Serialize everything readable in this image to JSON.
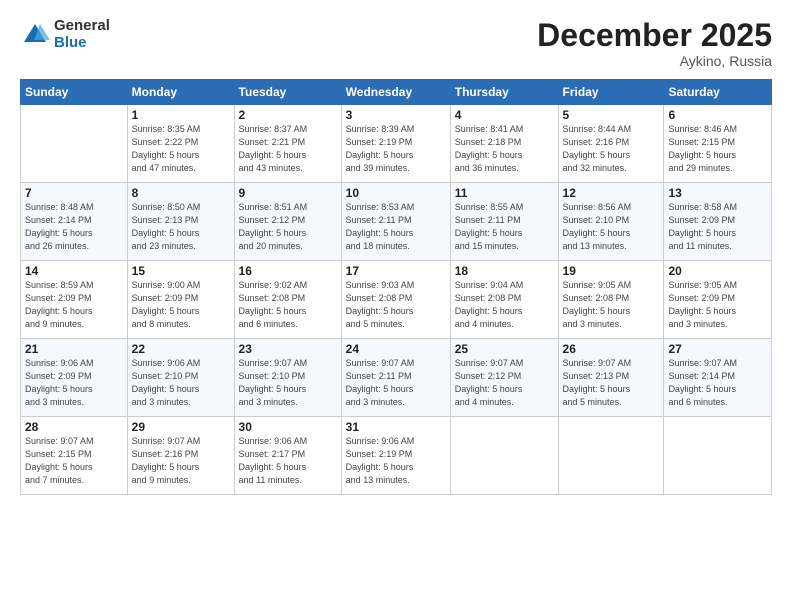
{
  "logo": {
    "general": "General",
    "blue": "Blue"
  },
  "title": "December 2025",
  "location": "Aykino, Russia",
  "days_header": [
    "Sunday",
    "Monday",
    "Tuesday",
    "Wednesday",
    "Thursday",
    "Friday",
    "Saturday"
  ],
  "weeks": [
    [
      {
        "day": "",
        "info": ""
      },
      {
        "day": "1",
        "info": "Sunrise: 8:35 AM\nSunset: 2:22 PM\nDaylight: 5 hours\nand 47 minutes."
      },
      {
        "day": "2",
        "info": "Sunrise: 8:37 AM\nSunset: 2:21 PM\nDaylight: 5 hours\nand 43 minutes."
      },
      {
        "day": "3",
        "info": "Sunrise: 8:39 AM\nSunset: 2:19 PM\nDaylight: 5 hours\nand 39 minutes."
      },
      {
        "day": "4",
        "info": "Sunrise: 8:41 AM\nSunset: 2:18 PM\nDaylight: 5 hours\nand 36 minutes."
      },
      {
        "day": "5",
        "info": "Sunrise: 8:44 AM\nSunset: 2:16 PM\nDaylight: 5 hours\nand 32 minutes."
      },
      {
        "day": "6",
        "info": "Sunrise: 8:46 AM\nSunset: 2:15 PM\nDaylight: 5 hours\nand 29 minutes."
      }
    ],
    [
      {
        "day": "7",
        "info": "Sunrise: 8:48 AM\nSunset: 2:14 PM\nDaylight: 5 hours\nand 26 minutes."
      },
      {
        "day": "8",
        "info": "Sunrise: 8:50 AM\nSunset: 2:13 PM\nDaylight: 5 hours\nand 23 minutes."
      },
      {
        "day": "9",
        "info": "Sunrise: 8:51 AM\nSunset: 2:12 PM\nDaylight: 5 hours\nand 20 minutes."
      },
      {
        "day": "10",
        "info": "Sunrise: 8:53 AM\nSunset: 2:11 PM\nDaylight: 5 hours\nand 18 minutes."
      },
      {
        "day": "11",
        "info": "Sunrise: 8:55 AM\nSunset: 2:11 PM\nDaylight: 5 hours\nand 15 minutes."
      },
      {
        "day": "12",
        "info": "Sunrise: 8:56 AM\nSunset: 2:10 PM\nDaylight: 5 hours\nand 13 minutes."
      },
      {
        "day": "13",
        "info": "Sunrise: 8:58 AM\nSunset: 2:09 PM\nDaylight: 5 hours\nand 11 minutes."
      }
    ],
    [
      {
        "day": "14",
        "info": "Sunrise: 8:59 AM\nSunset: 2:09 PM\nDaylight: 5 hours\nand 9 minutes."
      },
      {
        "day": "15",
        "info": "Sunrise: 9:00 AM\nSunset: 2:09 PM\nDaylight: 5 hours\nand 8 minutes."
      },
      {
        "day": "16",
        "info": "Sunrise: 9:02 AM\nSunset: 2:08 PM\nDaylight: 5 hours\nand 6 minutes."
      },
      {
        "day": "17",
        "info": "Sunrise: 9:03 AM\nSunset: 2:08 PM\nDaylight: 5 hours\nand 5 minutes."
      },
      {
        "day": "18",
        "info": "Sunrise: 9:04 AM\nSunset: 2:08 PM\nDaylight: 5 hours\nand 4 minutes."
      },
      {
        "day": "19",
        "info": "Sunrise: 9:05 AM\nSunset: 2:08 PM\nDaylight: 5 hours\nand 3 minutes."
      },
      {
        "day": "20",
        "info": "Sunrise: 9:05 AM\nSunset: 2:09 PM\nDaylight: 5 hours\nand 3 minutes."
      }
    ],
    [
      {
        "day": "21",
        "info": "Sunrise: 9:06 AM\nSunset: 2:09 PM\nDaylight: 5 hours\nand 3 minutes."
      },
      {
        "day": "22",
        "info": "Sunrise: 9:06 AM\nSunset: 2:10 PM\nDaylight: 5 hours\nand 3 minutes."
      },
      {
        "day": "23",
        "info": "Sunrise: 9:07 AM\nSunset: 2:10 PM\nDaylight: 5 hours\nand 3 minutes."
      },
      {
        "day": "24",
        "info": "Sunrise: 9:07 AM\nSunset: 2:11 PM\nDaylight: 5 hours\nand 3 minutes."
      },
      {
        "day": "25",
        "info": "Sunrise: 9:07 AM\nSunset: 2:12 PM\nDaylight: 5 hours\nand 4 minutes."
      },
      {
        "day": "26",
        "info": "Sunrise: 9:07 AM\nSunset: 2:13 PM\nDaylight: 5 hours\nand 5 minutes."
      },
      {
        "day": "27",
        "info": "Sunrise: 9:07 AM\nSunset: 2:14 PM\nDaylight: 5 hours\nand 6 minutes."
      }
    ],
    [
      {
        "day": "28",
        "info": "Sunrise: 9:07 AM\nSunset: 2:15 PM\nDaylight: 5 hours\nand 7 minutes."
      },
      {
        "day": "29",
        "info": "Sunrise: 9:07 AM\nSunset: 2:16 PM\nDaylight: 5 hours\nand 9 minutes."
      },
      {
        "day": "30",
        "info": "Sunrise: 9:06 AM\nSunset: 2:17 PM\nDaylight: 5 hours\nand 11 minutes."
      },
      {
        "day": "31",
        "info": "Sunrise: 9:06 AM\nSunset: 2:19 PM\nDaylight: 5 hours\nand 13 minutes."
      },
      {
        "day": "",
        "info": ""
      },
      {
        "day": "",
        "info": ""
      },
      {
        "day": "",
        "info": ""
      }
    ]
  ]
}
